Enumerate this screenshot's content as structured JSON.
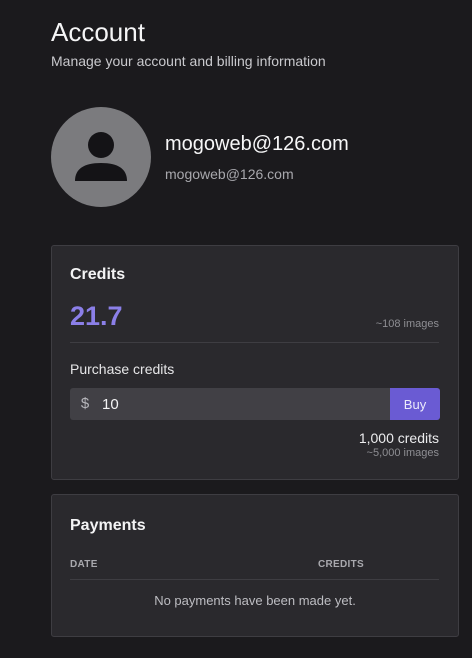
{
  "header": {
    "title": "Account",
    "subtitle": "Manage your account and billing information"
  },
  "profile": {
    "avatar_icon": "user-icon",
    "name": "mogoweb@126.com",
    "email": "mogoweb@126.com"
  },
  "credits": {
    "title": "Credits",
    "value": "21.7",
    "images": "~108 images",
    "purchase_label": "Purchase credits",
    "currency_symbol": "$",
    "amount": "10",
    "buy_label": "Buy",
    "result_credits": "1,000 credits",
    "result_images": "~5,000 images"
  },
  "payments": {
    "title": "Payments",
    "columns": [
      "DATE",
      "CREDITS"
    ],
    "empty_message": "No payments have been made yet."
  },
  "colors": {
    "background": "#1b1a1d",
    "card": "#2a292d",
    "accent": "#6a5bd3",
    "credits_value": "#8b7fe8"
  }
}
